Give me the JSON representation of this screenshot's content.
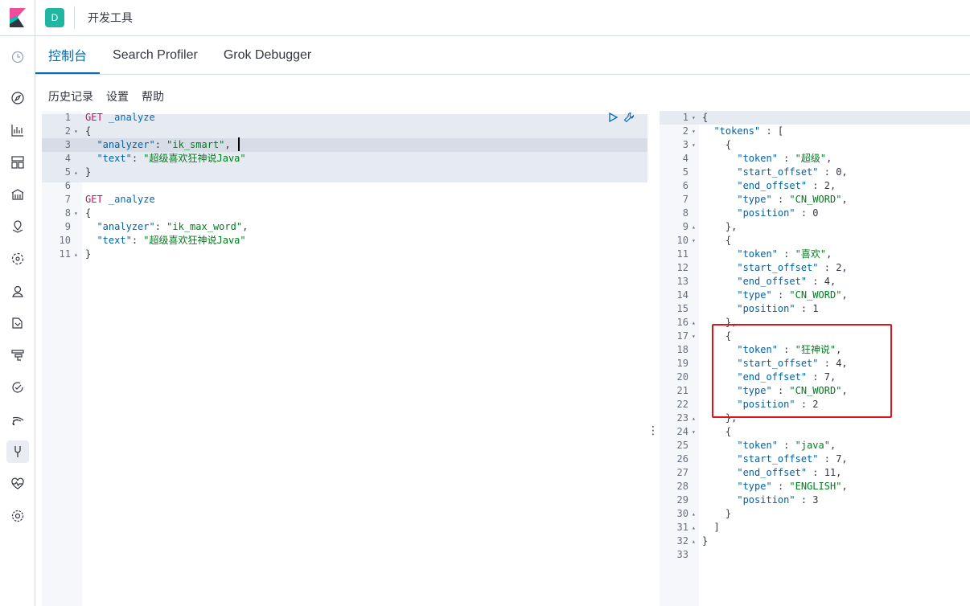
{
  "header": {
    "space_badge": "D",
    "app_title": "开发工具"
  },
  "tabs": [
    {
      "label": "控制台",
      "active": true
    },
    {
      "label": "Search Profiler",
      "active": false
    },
    {
      "label": "Grok Debugger",
      "active": false
    }
  ],
  "menu": {
    "history": "历史记录",
    "settings": "设置",
    "help": "帮助"
  },
  "nav_icons": [
    "clock-icon",
    "compass-icon",
    "visualize-icon",
    "dashboard-icon",
    "canvas-icon",
    "maps-icon",
    "ml-icon",
    "infrastructure-icon",
    "logs-icon",
    "apm-icon",
    "uptime-icon",
    "siem-icon",
    "devtools-icon",
    "monitoring-icon",
    "management-icon"
  ],
  "colors": {
    "accent": "#006bb4",
    "method": "#c80a68",
    "string": "#007d1d",
    "highlight_box": "#e0121a",
    "space_badge": "#1fb7a2"
  },
  "request_editor": {
    "lines": [
      {
        "n": "1",
        "fold": "",
        "html": "<span class='m'>GET</span> <span class='k'>_analyze</span>"
      },
      {
        "n": "2",
        "fold": "▾",
        "html": "{"
      },
      {
        "n": "3",
        "fold": "",
        "html": "  <span class='n'>\"analyzer\"</span>: <span class='s'>\"ik_smart\"</span>,"
      },
      {
        "n": "4",
        "fold": "",
        "html": "  <span class='n'>\"text\"</span>: <span class='s'>\"超级喜欢狂神说Java\"</span>"
      },
      {
        "n": "5",
        "fold": "▴",
        "html": "}"
      },
      {
        "n": "6",
        "fold": "",
        "html": ""
      },
      {
        "n": "7",
        "fold": "",
        "html": "<span class='m'>GET</span> <span class='k'>_analyze</span>"
      },
      {
        "n": "8",
        "fold": "▾",
        "html": "{"
      },
      {
        "n": "9",
        "fold": "",
        "html": "  <span class='n'>\"analyzer\"</span>: <span class='s'>\"ik_max_word\"</span>,"
      },
      {
        "n": "10",
        "fold": "",
        "html": "  <span class='n'>\"text\"</span>: <span class='s'>\"超级喜欢狂神说Java\"</span>"
      },
      {
        "n": "11",
        "fold": "▴",
        "html": "}"
      }
    ]
  },
  "response_editor": {
    "lines": [
      {
        "n": "1",
        "fold": "▾",
        "html": "{"
      },
      {
        "n": "2",
        "fold": "▾",
        "html": "  <span class='n'>\"tokens\"</span> : ["
      },
      {
        "n": "3",
        "fold": "▾",
        "html": "    {"
      },
      {
        "n": "4",
        "fold": "",
        "html": "      <span class='n'>\"token\"</span> : <span class='s'>\"超级\"</span>,"
      },
      {
        "n": "5",
        "fold": "",
        "html": "      <span class='n'>\"start_offset\"</span> : 0,"
      },
      {
        "n": "6",
        "fold": "",
        "html": "      <span class='n'>\"end_offset\"</span> : 2,"
      },
      {
        "n": "7",
        "fold": "",
        "html": "      <span class='n'>\"type\"</span> : <span class='s'>\"CN_WORD\"</span>,"
      },
      {
        "n": "8",
        "fold": "",
        "html": "      <span class='n'>\"position\"</span> : 0"
      },
      {
        "n": "9",
        "fold": "▴",
        "html": "    },"
      },
      {
        "n": "10",
        "fold": "▾",
        "html": "    {"
      },
      {
        "n": "11",
        "fold": "",
        "html": "      <span class='n'>\"token\"</span> : <span class='s'>\"喜欢\"</span>,"
      },
      {
        "n": "12",
        "fold": "",
        "html": "      <span class='n'>\"start_offset\"</span> : 2,"
      },
      {
        "n": "13",
        "fold": "",
        "html": "      <span class='n'>\"end_offset\"</span> : 4,"
      },
      {
        "n": "14",
        "fold": "",
        "html": "      <span class='n'>\"type\"</span> : <span class='s'>\"CN_WORD\"</span>,"
      },
      {
        "n": "15",
        "fold": "",
        "html": "      <span class='n'>\"position\"</span> : 1"
      },
      {
        "n": "16",
        "fold": "▴",
        "html": "    },"
      },
      {
        "n": "17",
        "fold": "▾",
        "html": "    {"
      },
      {
        "n": "18",
        "fold": "",
        "html": "      <span class='n'>\"token\"</span> : <span class='s'>\"狂神说\"</span>,"
      },
      {
        "n": "19",
        "fold": "",
        "html": "      <span class='n'>\"start_offset\"</span> : 4,"
      },
      {
        "n": "20",
        "fold": "",
        "html": "      <span class='n'>\"end_offset\"</span> : 7,"
      },
      {
        "n": "21",
        "fold": "",
        "html": "      <span class='n'>\"type\"</span> : <span class='s'>\"CN_WORD\"</span>,"
      },
      {
        "n": "22",
        "fold": "",
        "html": "      <span class='n'>\"position\"</span> : 2"
      },
      {
        "n": "23",
        "fold": "▴",
        "html": "    },"
      },
      {
        "n": "24",
        "fold": "▾",
        "html": "    {"
      },
      {
        "n": "25",
        "fold": "",
        "html": "      <span class='n'>\"token\"</span> : <span class='s'>\"java\"</span>,"
      },
      {
        "n": "26",
        "fold": "",
        "html": "      <span class='n'>\"start_offset\"</span> : 7,"
      },
      {
        "n": "27",
        "fold": "",
        "html": "      <span class='n'>\"end_offset\"</span> : 11,"
      },
      {
        "n": "28",
        "fold": "",
        "html": "      <span class='n'>\"type\"</span> : <span class='s'>\"ENGLISH\"</span>,"
      },
      {
        "n": "29",
        "fold": "",
        "html": "      <span class='n'>\"position\"</span> : 3"
      },
      {
        "n": "30",
        "fold": "▴",
        "html": "    }"
      },
      {
        "n": "31",
        "fold": "▴",
        "html": "  ]"
      },
      {
        "n": "32",
        "fold": "▴",
        "html": "}"
      },
      {
        "n": "33",
        "fold": "",
        "html": ""
      }
    ]
  }
}
